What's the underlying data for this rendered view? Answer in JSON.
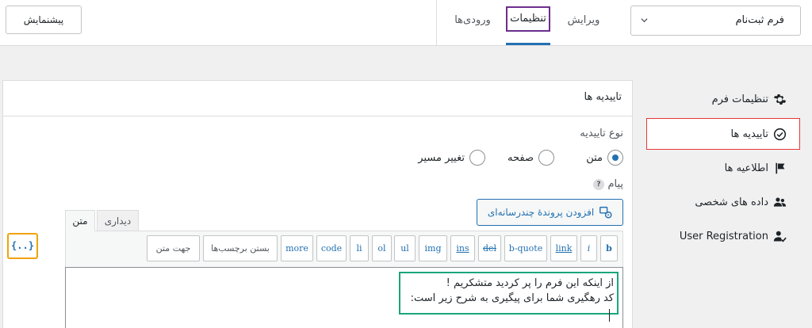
{
  "header": {
    "form_select_value": "فرم ثبت‌نام",
    "tabs": [
      {
        "label": "ویرایش"
      },
      {
        "label": "تنظیمات"
      },
      {
        "label": "ورودی‌ها"
      }
    ],
    "preview_label": "پیشنمایش"
  },
  "sidebar": {
    "items": [
      {
        "label": "تنظیمات فرم",
        "icon": "gear-icon"
      },
      {
        "label": "تاییدیه ها",
        "icon": "check-circle-icon"
      },
      {
        "label": "اطلاعیه ها",
        "icon": "flag-icon"
      },
      {
        "label": "داده های شخصی",
        "icon": "users-icon"
      },
      {
        "label": "User Registration",
        "icon": "user-check-icon"
      }
    ]
  },
  "panel": {
    "title": "تاییدیه ها",
    "type_label": "نوع تاییدیه",
    "radios": [
      {
        "label": "متن",
        "checked": true
      },
      {
        "label": "صفحه",
        "checked": false
      },
      {
        "label": "تغییر مسیر",
        "checked": false
      }
    ],
    "message_label": "پیام",
    "help": "?",
    "add_media_label": "افزودن پروندهٔ چندرسانه‌ای",
    "editor_tabs": {
      "text": "متن",
      "visual": "دیداری"
    },
    "toolbar": {
      "b": "b",
      "i": "i",
      "link": "link",
      "bquote": "b-quote",
      "del": "del",
      "ins": "ins",
      "img": "img",
      "ul": "ul",
      "ol": "ol",
      "li": "li",
      "code": "code",
      "more": "more",
      "close_tags": "بستن برچسب‌ها",
      "direction": "جهت متن"
    },
    "message_lines": [
      "از اینکه این فرم را پر کردید متشکریم !",
      "کد رهگیری شما برای پیگیری به شرح زیر است:"
    ],
    "smart_tags": "{..}"
  },
  "colors": {
    "accent": "#2271b1",
    "settings_tab_highlight": "#6b2e8e",
    "confirm_highlight": "#e53935",
    "message_highlight": "#1aa67a",
    "smart_tag_highlight": "#f0a30a"
  }
}
